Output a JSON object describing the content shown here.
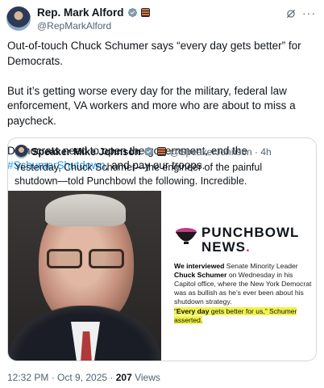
{
  "author": {
    "display_name": "Rep. Mark Alford",
    "handle": "@RepMarkAlford"
  },
  "tweet": {
    "paragraph1": "Out-of-touch Chuck Schumer says “every day gets better” for Democrats.",
    "paragraph2": "But it’s getting worse every day for the military, federal law enforcement, VA workers and more who are about to miss a paycheck.",
    "paragraph3_before": "Democrats need to open the government, end the ",
    "paragraph3_hashtag": "#SchumerShutdown",
    "paragraph3_after": ", and pay our troops."
  },
  "quoted": {
    "display_name": "Speaker Mike Johnson",
    "handle_time": "@SpeakerJohnson · 4h",
    "text": "Yesterday, Chuck Schumer—the engineer of the painful shutdown—told Punchbowl the following. Incredible.",
    "article": {
      "brand_line1": "PUNCHBOWL",
      "brand_line2": "NEWS",
      "body_b1": "We interviewed",
      "body_t1": " Senate Minority Leader ",
      "body_b2": "Chuck Schumer",
      "body_t2": " on Wednesday in his Capitol office, where the New York Democrat was as bullish as he’s ever been about his shutdown strategy.",
      "quote_open": "“",
      "quote_bold": "Every day",
      "quote_rest": " gets better for us,” Schumer asserted."
    }
  },
  "footer": {
    "time_date": "12:32 PM · Oct 9, 2025 · ",
    "views_count": "207",
    "views_label": " Views"
  },
  "colors": {
    "accent": "#1d9bf0",
    "highlight": "#f2f24a"
  }
}
